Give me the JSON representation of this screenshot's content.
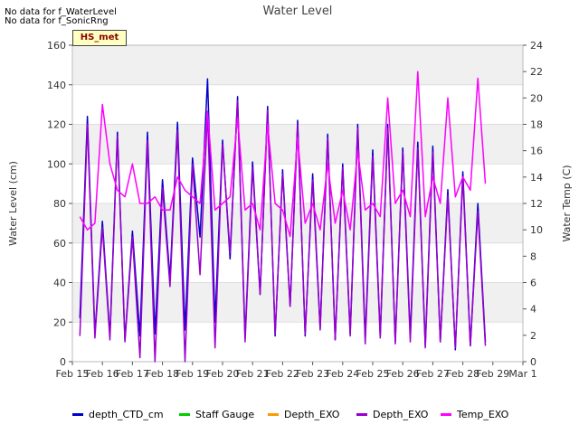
{
  "notes": [
    "No data for f_WaterLevel",
    "No data for f_SonicRng"
  ],
  "badge": "HS_met",
  "chart_data": {
    "type": "line",
    "title": "Water Level",
    "ylabel": "Water Level (cm)",
    "y2label": "Water Temp (C)",
    "ylim": [
      0,
      160
    ],
    "y2lim": [
      0,
      24
    ],
    "yticks": [
      0,
      20,
      40,
      60,
      80,
      100,
      120,
      140,
      160
    ],
    "y2ticks": [
      0,
      2,
      4,
      6,
      8,
      10,
      12,
      14,
      16,
      18,
      20,
      22,
      24
    ],
    "x_ticks": [
      "Feb 15",
      "Feb 16",
      "Feb 17",
      "Feb 18",
      "Feb 19",
      "Feb 20",
      "Feb 21",
      "Feb 22",
      "Feb 23",
      "Feb 24",
      "Feb 25",
      "Feb 26",
      "Feb 27",
      "Feb 28",
      "Feb 29",
      "Mar 1"
    ],
    "grid": true,
    "legend_position": "bottom",
    "series": [
      {
        "name": "depth_CTD_cm",
        "color": "#0000cc",
        "axis": "left",
        "values": [
          [
            "2024-02-15 06:00",
            22
          ],
          [
            "2024-02-15 12:00",
            124
          ],
          [
            "2024-02-15 18:00",
            14
          ],
          [
            "2024-02-16 00:00",
            71
          ],
          [
            "2024-02-16 06:00",
            13
          ],
          [
            "2024-02-16 12:00",
            116
          ],
          [
            "2024-02-16 18:00",
            11
          ],
          [
            "2024-02-17 00:00",
            66
          ],
          [
            "2024-02-17 06:00",
            13
          ],
          [
            "2024-02-17 12:00",
            116
          ],
          [
            "2024-02-17 18:00",
            14
          ],
          [
            "2024-02-18 00:00",
            92
          ],
          [
            "2024-02-18 06:00",
            42
          ],
          [
            "2024-02-18 12:00",
            121
          ],
          [
            "2024-02-18 18:00",
            16
          ],
          [
            "2024-02-19 00:00",
            103
          ],
          [
            "2024-02-19 06:00",
            63
          ],
          [
            "2024-02-19 12:00",
            143
          ],
          [
            "2024-02-19 18:00",
            20
          ],
          [
            "2024-02-20 00:00",
            112
          ],
          [
            "2024-02-20 06:00",
            52
          ],
          [
            "2024-02-20 12:00",
            134
          ],
          [
            "2024-02-20 18:00",
            12
          ],
          [
            "2024-02-21 00:00",
            101
          ],
          [
            "2024-02-21 06:00",
            34
          ],
          [
            "2024-02-21 12:00",
            129
          ],
          [
            "2024-02-21 18:00",
            13
          ],
          [
            "2024-02-22 00:00",
            97
          ],
          [
            "2024-02-22 06:00",
            28
          ],
          [
            "2024-02-22 12:00",
            122
          ],
          [
            "2024-02-22 18:00",
            13
          ],
          [
            "2024-02-23 00:00",
            95
          ],
          [
            "2024-02-23 06:00",
            17
          ],
          [
            "2024-02-23 12:00",
            115
          ],
          [
            "2024-02-23 18:00",
            11
          ],
          [
            "2024-02-24 00:00",
            100
          ],
          [
            "2024-02-24 06:00",
            14
          ],
          [
            "2024-02-24 12:00",
            120
          ],
          [
            "2024-02-24 18:00",
            12
          ],
          [
            "2024-02-25 00:00",
            107
          ],
          [
            "2024-02-25 06:00",
            13
          ],
          [
            "2024-02-25 12:00",
            120
          ],
          [
            "2024-02-25 18:00",
            10
          ],
          [
            "2024-02-26 00:00",
            108
          ],
          [
            "2024-02-26 06:00",
            13
          ],
          [
            "2024-02-26 12:00",
            111
          ],
          [
            "2024-02-26 18:00",
            8
          ],
          [
            "2024-02-27 00:00",
            109
          ],
          [
            "2024-02-27 06:00",
            10
          ],
          [
            "2024-02-27 12:00",
            87
          ],
          [
            "2024-02-27 18:00",
            6
          ],
          [
            "2024-02-28 00:00",
            96
          ],
          [
            "2024-02-28 06:00",
            8
          ],
          [
            "2024-02-28 12:00",
            80
          ],
          [
            "2024-02-28 18:00",
            10
          ]
        ]
      },
      {
        "name": "Staff Gauge",
        "color": "#00cc00",
        "axis": "left",
        "values": []
      },
      {
        "name": "Depth_EXO",
        "color": "#ff9900",
        "axis": "left",
        "values": []
      },
      {
        "name": "Depth_EXO",
        "color": "#9900cc",
        "axis": "left",
        "values": [
          [
            "2024-02-15 06:00",
            13
          ],
          [
            "2024-02-15 12:00",
            120
          ],
          [
            "2024-02-15 18:00",
            12
          ],
          [
            "2024-02-16 00:00",
            68
          ],
          [
            "2024-02-16 06:00",
            11
          ],
          [
            "2024-02-16 12:00",
            114
          ],
          [
            "2024-02-16 18:00",
            10
          ],
          [
            "2024-02-17 00:00",
            63
          ],
          [
            "2024-02-17 06:00",
            2
          ],
          [
            "2024-02-17 12:00",
            112
          ],
          [
            "2024-02-17 18:00",
            0
          ],
          [
            "2024-02-18 00:00",
            88
          ],
          [
            "2024-02-18 06:00",
            38
          ],
          [
            "2024-02-18 12:00",
            117
          ],
          [
            "2024-02-18 18:00",
            0
          ],
          [
            "2024-02-19 00:00",
            100
          ],
          [
            "2024-02-19 06:00",
            44
          ],
          [
            "2024-02-19 12:00",
            126
          ],
          [
            "2024-02-19 18:00",
            7
          ],
          [
            "2024-02-20 00:00",
            110
          ],
          [
            "2024-02-20 06:00",
            55
          ],
          [
            "2024-02-20 12:00",
            132
          ],
          [
            "2024-02-20 18:00",
            10
          ],
          [
            "2024-02-21 00:00",
            98
          ],
          [
            "2024-02-21 06:00",
            34
          ],
          [
            "2024-02-21 12:00",
            127
          ],
          [
            "2024-02-21 18:00",
            14
          ],
          [
            "2024-02-22 00:00",
            95
          ],
          [
            "2024-02-22 06:00",
            28
          ],
          [
            "2024-02-22 12:00",
            120
          ],
          [
            "2024-02-22 18:00",
            14
          ],
          [
            "2024-02-23 00:00",
            92
          ],
          [
            "2024-02-23 06:00",
            16
          ],
          [
            "2024-02-23 12:00",
            113
          ],
          [
            "2024-02-23 18:00",
            11
          ],
          [
            "2024-02-24 00:00",
            98
          ],
          [
            "2024-02-24 06:00",
            13
          ],
          [
            "2024-02-24 12:00",
            118
          ],
          [
            "2024-02-24 18:00",
            9
          ],
          [
            "2024-02-25 00:00",
            104
          ],
          [
            "2024-02-25 06:00",
            12
          ],
          [
            "2024-02-25 12:00",
            118
          ],
          [
            "2024-02-25 18:00",
            9
          ],
          [
            "2024-02-26 00:00",
            106
          ],
          [
            "2024-02-26 06:00",
            10
          ],
          [
            "2024-02-26 12:00",
            108
          ],
          [
            "2024-02-26 18:00",
            7
          ],
          [
            "2024-02-27 00:00",
            106
          ],
          [
            "2024-02-27 06:00",
            10
          ],
          [
            "2024-02-27 12:00",
            84
          ],
          [
            "2024-02-27 18:00",
            7
          ],
          [
            "2024-02-28 00:00",
            93
          ],
          [
            "2024-02-28 06:00",
            8
          ],
          [
            "2024-02-28 12:00",
            76
          ],
          [
            "2024-02-28 18:00",
            8
          ]
        ]
      },
      {
        "name": "Temp_EXO",
        "color": "#ff00ff",
        "axis": "right",
        "values": [
          [
            "2024-02-15 06:00",
            11.0
          ],
          [
            "2024-02-15 12:00",
            10.0
          ],
          [
            "2024-02-15 18:00",
            10.5
          ],
          [
            "2024-02-16 00:00",
            19.5
          ],
          [
            "2024-02-16 06:00",
            15.0
          ],
          [
            "2024-02-16 12:00",
            13.0
          ],
          [
            "2024-02-16 18:00",
            12.5
          ],
          [
            "2024-02-17 00:00",
            15.0
          ],
          [
            "2024-02-17 06:00",
            12.0
          ],
          [
            "2024-02-17 12:00",
            12.0
          ],
          [
            "2024-02-17 18:00",
            12.5
          ],
          [
            "2024-02-18 00:00",
            11.5
          ],
          [
            "2024-02-18 06:00",
            11.5
          ],
          [
            "2024-02-18 12:00",
            14.0
          ],
          [
            "2024-02-18 18:00",
            13.0
          ],
          [
            "2024-02-19 00:00",
            12.5
          ],
          [
            "2024-02-19 06:00",
            12.0
          ],
          [
            "2024-02-19 12:00",
            19.0
          ],
          [
            "2024-02-19 18:00",
            11.5
          ],
          [
            "2024-02-20 00:00",
            12.0
          ],
          [
            "2024-02-20 06:00",
            12.5
          ],
          [
            "2024-02-20 12:00",
            18.5
          ],
          [
            "2024-02-20 18:00",
            11.5
          ],
          [
            "2024-02-21 00:00",
            12.0
          ],
          [
            "2024-02-21 06:00",
            10.0
          ],
          [
            "2024-02-21 12:00",
            18.0
          ],
          [
            "2024-02-21 18:00",
            12.0
          ],
          [
            "2024-02-22 00:00",
            11.5
          ],
          [
            "2024-02-22 06:00",
            9.5
          ],
          [
            "2024-02-22 12:00",
            17.0
          ],
          [
            "2024-02-22 18:00",
            10.5
          ],
          [
            "2024-02-23 00:00",
            12.0
          ],
          [
            "2024-02-23 06:00",
            10.0
          ],
          [
            "2024-02-23 12:00",
            15.0
          ],
          [
            "2024-02-23 18:00",
            10.5
          ],
          [
            "2024-02-24 00:00",
            13.0
          ],
          [
            "2024-02-24 06:00",
            10.0
          ],
          [
            "2024-02-24 12:00",
            16.0
          ],
          [
            "2024-02-24 18:00",
            11.5
          ],
          [
            "2024-02-25 00:00",
            12.0
          ],
          [
            "2024-02-25 06:00",
            11.0
          ],
          [
            "2024-02-25 12:00",
            20.0
          ],
          [
            "2024-02-25 18:00",
            12.0
          ],
          [
            "2024-02-26 00:00",
            13.0
          ],
          [
            "2024-02-26 06:00",
            11.0
          ],
          [
            "2024-02-26 12:00",
            22.0
          ],
          [
            "2024-02-26 18:00",
            11.0
          ],
          [
            "2024-02-27 00:00",
            14.0
          ],
          [
            "2024-02-27 06:00",
            12.0
          ],
          [
            "2024-02-27 12:00",
            20.0
          ],
          [
            "2024-02-27 18:00",
            12.5
          ],
          [
            "2024-02-28 00:00",
            14.0
          ],
          [
            "2024-02-28 06:00",
            13.0
          ],
          [
            "2024-02-28 12:00",
            21.5
          ],
          [
            "2024-02-28 18:00",
            13.5
          ]
        ]
      }
    ]
  }
}
